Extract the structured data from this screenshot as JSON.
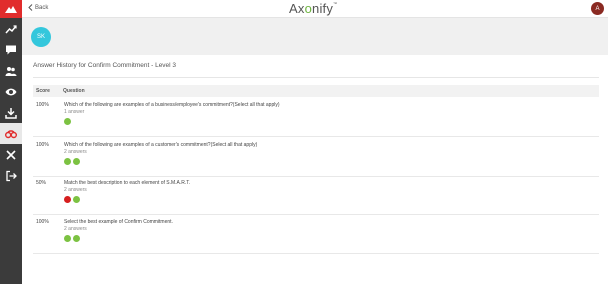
{
  "header": {
    "back_label": "Back",
    "brand_pre": "Ax",
    "brand_o": "o",
    "brand_post": "nify",
    "brand_tm": "™",
    "user_initial": "A"
  },
  "profile": {
    "initials": "SK"
  },
  "page_title": "Answer History for Confirm Commitment - Level 3",
  "table": {
    "col_score": "Score",
    "col_question": "Question",
    "rows": [
      {
        "score": "100%",
        "question": "Which of the following are examples of a business/employee's commitment?(Select all that apply)",
        "answers": "1 answer",
        "results": [
          "correct"
        ]
      },
      {
        "score": "100%",
        "question": "Which of the following are examples of a customer's commitment?(Select all that apply)",
        "answers": "2 answers",
        "results": [
          "correct",
          "correct"
        ]
      },
      {
        "score": "50%",
        "question": "Match the best description to each element of S.M.A.R.T.",
        "answers": "2 answers",
        "results": [
          "incorrect",
          "correct"
        ]
      },
      {
        "score": "100%",
        "question": "Select the best example of Confirm Commitment.",
        "answers": "2 answers",
        "results": [
          "correct",
          "correct"
        ]
      }
    ]
  },
  "sidebar_icons": [
    "trending-icon",
    "chat-icon",
    "people-icon",
    "eye-icon",
    "download-icon",
    "binoculars-icon",
    "tools-icon",
    "logout-icon"
  ],
  "colors": {
    "correct": "#7cc242",
    "incorrect": "#d61f1f",
    "accent": "#34c7dc",
    "brand_red": "#e12c2c"
  }
}
